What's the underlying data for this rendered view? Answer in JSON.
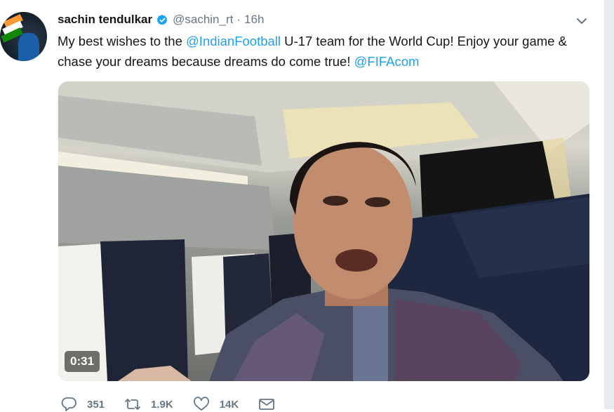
{
  "tweet": {
    "author_name": "sachin tendulkar",
    "handle": "@sachin_rt",
    "separator": "·",
    "time": "16h",
    "text_parts": {
      "p1": "My best wishes to the ",
      "m1": "@IndianFootball",
      "p2": " U-17 team for the World Cup! Enjoy your game & chase your dreams because dreams do come true! ",
      "m2": "@FIFAcom"
    },
    "video": {
      "duration": "0:31"
    },
    "actions": {
      "replies": "351",
      "retweets": "1.9K",
      "likes": "14K"
    }
  },
  "colors": {
    "mention": "#1da1f2",
    "secondary_text": "#657786",
    "verified_badge": "#1da1f2"
  },
  "icons": [
    "verified-badge-icon",
    "chevron-down-icon",
    "reply-icon",
    "retweet-icon",
    "like-icon",
    "message-icon"
  ]
}
